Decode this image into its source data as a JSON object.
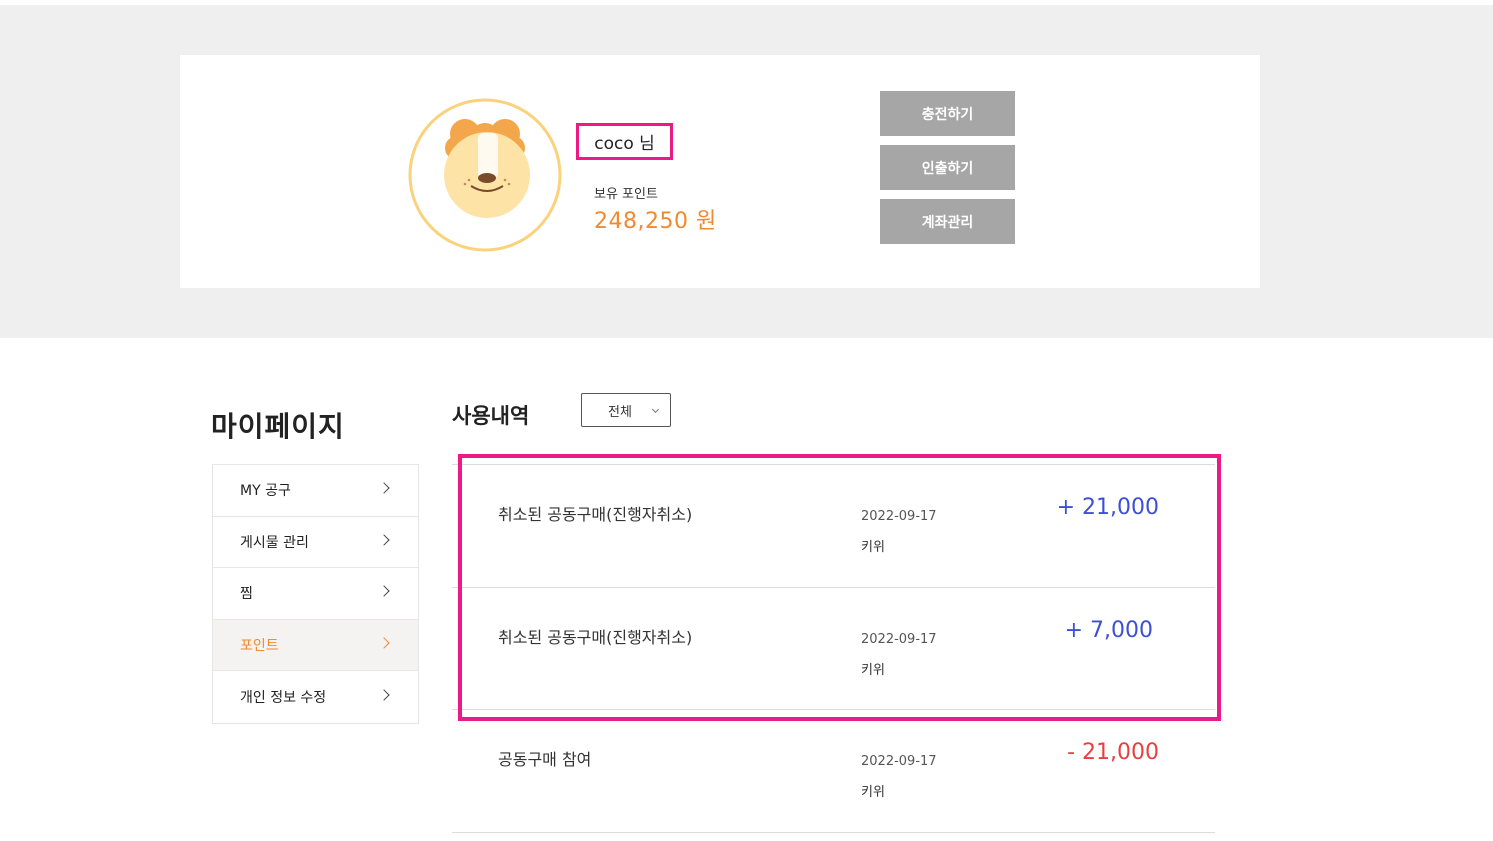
{
  "profile": {
    "nickname": "coco 님",
    "points_label": "보유 포인트",
    "points_value": "248,250 원",
    "buttons": {
      "charge": "충전하기",
      "withdraw": "인출하기",
      "account": "계좌관리"
    }
  },
  "sidebar": {
    "title": "마이페이지",
    "items": [
      {
        "label": "MY 공구"
      },
      {
        "label": "게시물 관리"
      },
      {
        "label": "찜"
      },
      {
        "label": "포인트"
      },
      {
        "label": "개인 정보 수정"
      }
    ],
    "active_index": 3
  },
  "history": {
    "title": "사용내역",
    "filter_selected": "전체",
    "rows": [
      {
        "desc": "취소된 공동구매(진행자취소)",
        "date": "2022-09-17",
        "who": "키위",
        "amount": "+ 21,000",
        "sign": "plus"
      },
      {
        "desc": "취소된 공동구매(진행자취소)",
        "date": "2022-09-17",
        "who": "키위",
        "amount": "+ 7,000",
        "sign": "plus"
      },
      {
        "desc": "공동구매 참여",
        "date": "2022-09-17",
        "who": "키위",
        "amount": "- 21,000",
        "sign": "minus"
      }
    ]
  },
  "colors": {
    "accent_orange": "#f08a2e",
    "plus_blue": "#3d4fd6",
    "minus_red": "#e84040",
    "highlight_pink": "#ea1b86",
    "button_gray": "#a6a6a6"
  }
}
